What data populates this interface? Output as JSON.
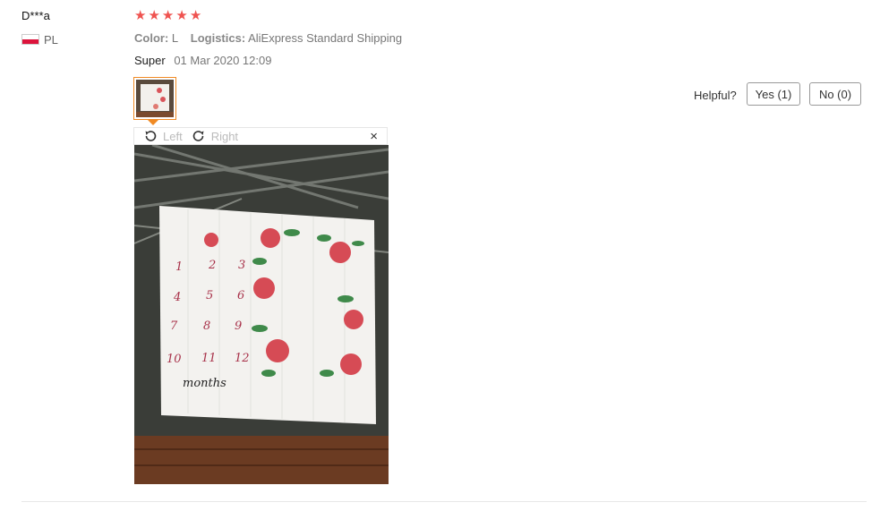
{
  "review": {
    "user": "D***a",
    "country": "PL",
    "flag_colors": [
      "#ffffff",
      "#dc143c"
    ],
    "rating": 5,
    "star_color": "#ef5350",
    "color_label": "Color:",
    "color_value": "L",
    "logistics_label": "Logistics:",
    "logistics_value": "AliExpress Standard Shipping",
    "text": "Super",
    "date": "01 Mar 2020 12:09",
    "thumb_accent": "#f08a24"
  },
  "viewer": {
    "rotate_left": "Left",
    "rotate_right": "Right",
    "close": "×",
    "photo_numbers": [
      "1",
      "2",
      "3",
      "4",
      "5",
      "6",
      "7",
      "8",
      "9",
      "10",
      "11",
      "12"
    ],
    "photo_caption": "months"
  },
  "helpful": {
    "label": "Helpful?",
    "yes": "Yes (1)",
    "no": "No (0)"
  }
}
